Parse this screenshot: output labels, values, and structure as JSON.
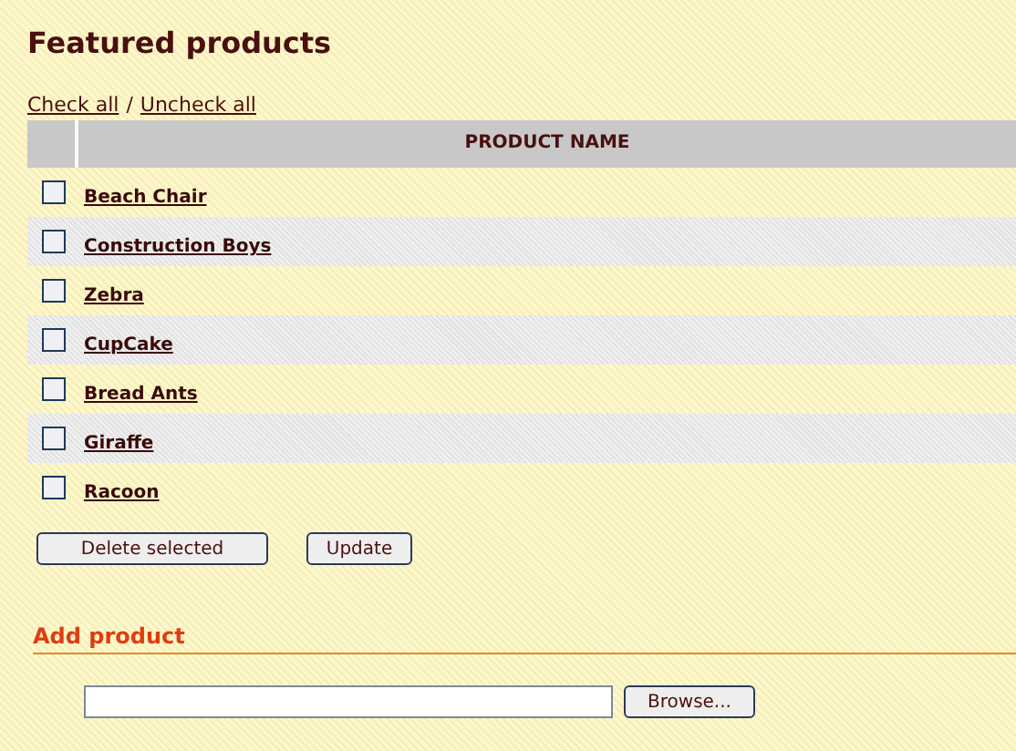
{
  "title": "Featured products",
  "links": {
    "check_all": "Check all",
    "separator": "/",
    "uncheck_all": "Uncheck all"
  },
  "table": {
    "columns": [
      "PRODUCT NAME"
    ],
    "rows": [
      {
        "name": "Beach Chair",
        "checked": false
      },
      {
        "name": "Construction Boys",
        "checked": false
      },
      {
        "name": "Zebra",
        "checked": false
      },
      {
        "name": "CupCake",
        "checked": false
      },
      {
        "name": "Bread Ants",
        "checked": false
      },
      {
        "name": "Giraffe",
        "checked": false
      },
      {
        "name": "Racoon",
        "checked": false
      }
    ]
  },
  "buttons": [
    "Delete selected",
    "Update"
  ],
  "add_product": {
    "heading": "Add product",
    "browse_button": "Browse..."
  }
}
